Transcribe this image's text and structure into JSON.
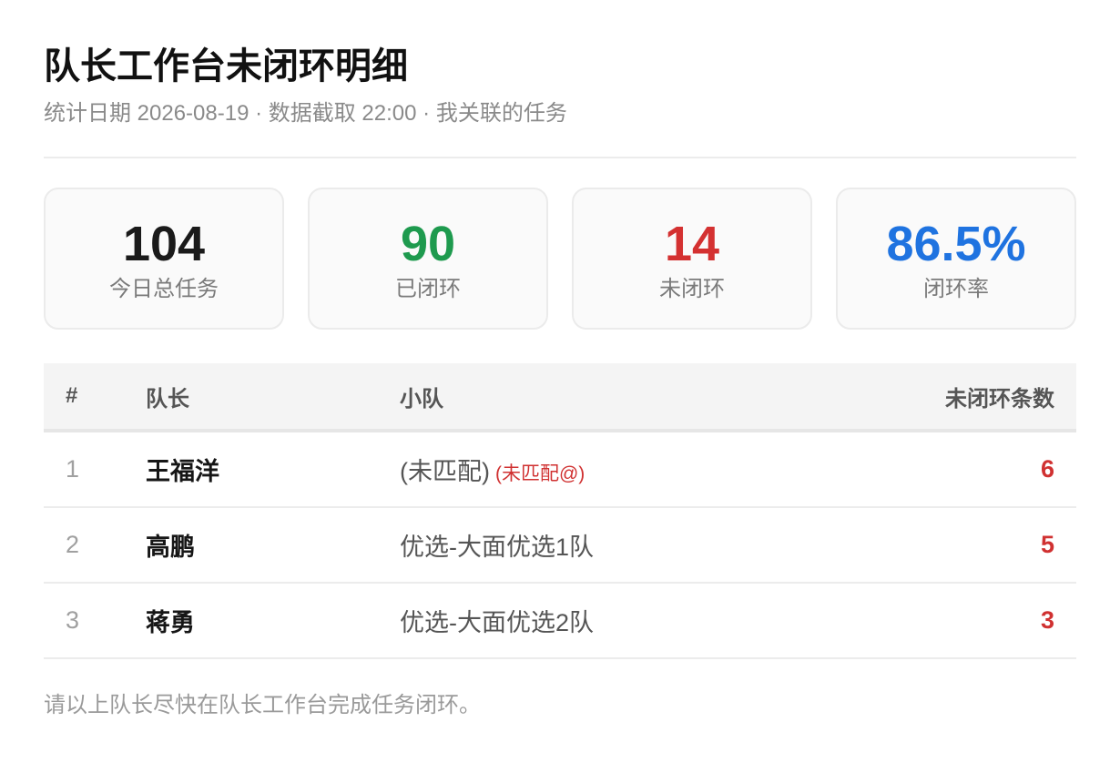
{
  "header": {
    "title": "队长工作台未闭环明细",
    "subtitle": "统计日期 2026-08-19 · 数据截取 22:00 · 我关联的任务"
  },
  "stats": [
    {
      "value": "104",
      "label": "今日总任务",
      "color": "#1a1a1a"
    },
    {
      "value": "90",
      "label": "已闭环",
      "color": "#1e9a4e"
    },
    {
      "value": "14",
      "label": "未闭环",
      "color": "#d43131"
    },
    {
      "value": "86.5%",
      "label": "闭环率",
      "color": "#1f73e0"
    }
  ],
  "table": {
    "headers": {
      "index": "#",
      "captain": "队长",
      "team": "小队",
      "count": "未闭环条数"
    },
    "rows": [
      {
        "index": "1",
        "captain": "王福洋",
        "team": "(未匹配)",
        "tag": "(未匹配@)",
        "count": "6"
      },
      {
        "index": "2",
        "captain": "高鹏",
        "team": "优选-大面优选1队",
        "tag": "",
        "count": "5"
      },
      {
        "index": "3",
        "captain": "蒋勇",
        "team": "优选-大面优选2队",
        "tag": "",
        "count": "3"
      }
    ]
  },
  "footer": {
    "note": "请以上队长尽快在队长工作台完成任务闭环。"
  }
}
